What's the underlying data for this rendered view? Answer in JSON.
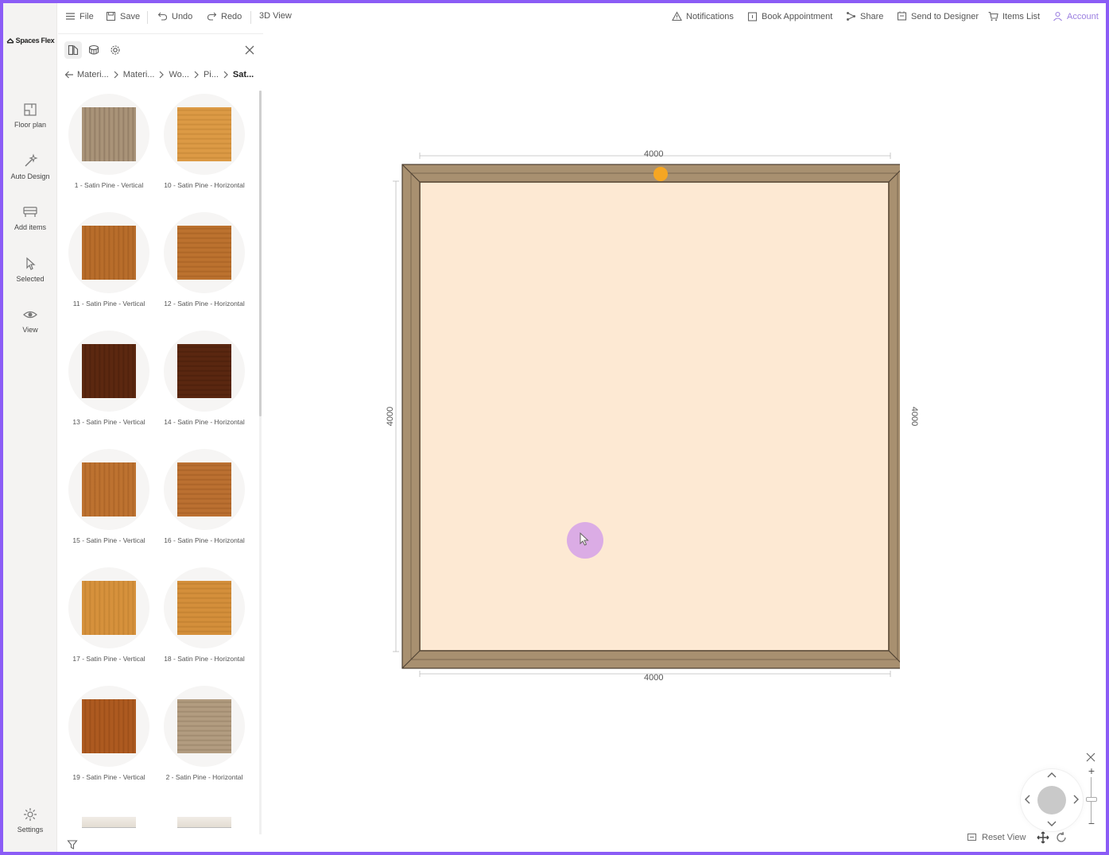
{
  "brand": {
    "name": "Spaces Flex"
  },
  "rail": {
    "items": [
      {
        "label": "Floor plan",
        "icon": "floor-plan-icon"
      },
      {
        "label": "Auto Design",
        "icon": "magic-wand-icon"
      },
      {
        "label": "Add items",
        "icon": "add-items-icon"
      },
      {
        "label": "Selected",
        "icon": "pointer-icon"
      },
      {
        "label": "View",
        "icon": "eye-icon"
      }
    ],
    "settings_label": "Settings"
  },
  "toolbar": {
    "file": "File",
    "save": "Save",
    "undo": "Undo",
    "redo": "Redo",
    "view3d": "3D View",
    "notifications": "Notifications",
    "book_appointment": "Book Appointment",
    "share": "Share",
    "send_to_designer": "Send to Designer",
    "items_list": "Items List",
    "account": "Account"
  },
  "panel": {
    "breadcrumb": [
      "Materi...",
      "Materi...",
      "Wo...",
      "Pi...",
      "Sat..."
    ],
    "swatches": [
      {
        "label": "1 - Satin Pine - Vertical",
        "color": "#a99378",
        "grain": "#8f7a62"
      },
      {
        "label": "10 - Satin Pine - Horizontal",
        "color": "#dc9a45",
        "grain": "#c98a38"
      },
      {
        "label": "11 - Satin Pine - Vertical",
        "color": "#b86d2b",
        "grain": "#a55e22"
      },
      {
        "label": "12 - Satin Pine - Horizontal",
        "color": "#bc722f",
        "grain": "#a96325"
      },
      {
        "label": "13 - Satin Pine - Vertical",
        "color": "#5c2810",
        "grain": "#4e210c"
      },
      {
        "label": "14 - Satin Pine - Horizontal",
        "color": "#5a2710",
        "grain": "#4c200c"
      },
      {
        "label": "15 - Satin Pine - Vertical",
        "color": "#bd7230",
        "grain": "#aa6326"
      },
      {
        "label": "16 - Satin Pine - Horizontal",
        "color": "#bb7031",
        "grain": "#a86127"
      },
      {
        "label": "17 - Satin Pine - Vertical",
        "color": "#d6913c",
        "grain": "#c38232"
      },
      {
        "label": "18 - Satin Pine - Horizontal",
        "color": "#d48f3b",
        "grain": "#c18031"
      },
      {
        "label": "19 - Satin Pine - Vertical",
        "color": "#ad5a20",
        "grain": "#9a4d18"
      },
      {
        "label": "2 - Satin Pine - Horizontal",
        "color": "#b29c80",
        "grain": "#9c876c"
      }
    ]
  },
  "canvas": {
    "dim_top": "4000",
    "dim_bottom": "4000",
    "dim_left": "4000",
    "dim_right": "4000",
    "floor_color": "#fde9d3",
    "wall_color": "#a89070",
    "handle_color": "#f5a623"
  },
  "nav": {
    "reset_view": "Reset View"
  }
}
